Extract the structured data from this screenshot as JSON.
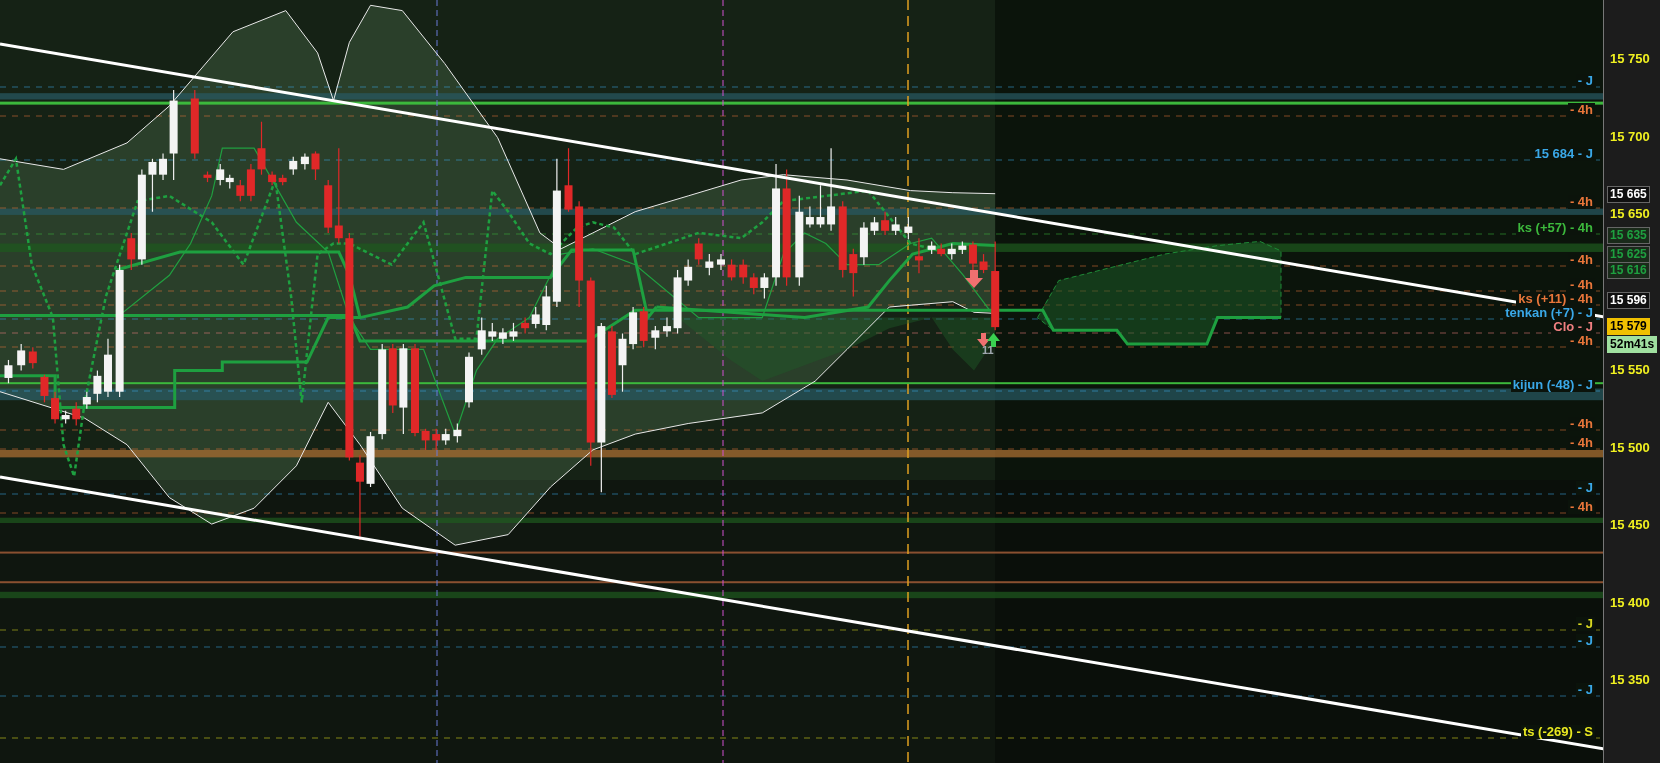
{
  "chart": {
    "level_labels": [
      {
        "text": "- J",
        "color": "#3aa8e8"
      },
      {
        "text": "- 4h",
        "color": "#e8763a"
      },
      {
        "text": "15 684 - J",
        "color": "#3aa8e8"
      },
      {
        "text": "- 4h",
        "color": "#e8763a"
      },
      {
        "text": "ks (+57) - 4h",
        "color": "#3cb83c"
      },
      {
        "text": "- 4h",
        "color": "#e8763a"
      },
      {
        "text": "- 4h",
        "color": "#e8763a"
      },
      {
        "text": "ks (+11) - 4h",
        "color": "#e8763a"
      },
      {
        "text": "tenkan (+7) - J",
        "color": "#3aa8e8"
      },
      {
        "text": "Clo - J",
        "color": "#f08080"
      },
      {
        "text": "- 4h",
        "color": "#e8763a"
      },
      {
        "text": "kijun (-48) - J",
        "color": "#3aa8e8"
      },
      {
        "text": "- 4h",
        "color": "#e8763a"
      },
      {
        "text": "- 4h",
        "color": "#e8763a"
      },
      {
        "text": "- J",
        "color": "#3aa8e8"
      },
      {
        "text": "- 4h",
        "color": "#e8763a"
      },
      {
        "text": "- J",
        "color": "#d8d820"
      },
      {
        "text": "- J",
        "color": "#3aa8e8"
      },
      {
        "text": "- J",
        "color": "#3aa8e8"
      },
      {
        "text": "ts (-269) - S",
        "color": "#e8e820"
      }
    ],
    "signal_count": "11"
  },
  "price_axis": {
    "ticks": [
      "15 750",
      "15 700",
      "15 650",
      "15 550",
      "15 500",
      "15 450",
      "15 400",
      "15 350"
    ],
    "tags": [
      {
        "text": "15 665",
        "kind": "plain"
      },
      {
        "text": "15 635",
        "kind": "level"
      },
      {
        "text": "15 625",
        "kind": "level"
      },
      {
        "text": "15 616",
        "kind": "level"
      },
      {
        "text": "15 596",
        "kind": "plain"
      },
      {
        "text": "15 579",
        "kind": "price"
      },
      {
        "text": "52m41s",
        "kind": "timer"
      }
    ]
  }
}
